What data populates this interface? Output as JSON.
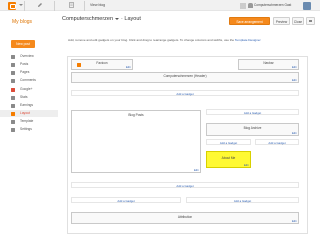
{
  "topbar": {
    "view_blog": "View blog",
    "user_name": "Computerschmerzen Gast",
    "icons": [
      "blogger-logo-icon",
      "pencil-icon",
      "document-icon",
      "apps-grid-icon",
      "notifications-icon"
    ]
  },
  "header": {
    "my_blogs": "My blogs",
    "blog_name": "Computerschmerzen",
    "page": "Layout",
    "save": "Save arrangement",
    "preview": "Preview",
    "close": "Close"
  },
  "sidebar": {
    "new_post": "New post",
    "items": [
      {
        "label": "Overview",
        "icon": "overview-icon",
        "color": "#8a8a8a"
      },
      {
        "label": "Posts",
        "icon": "posts-icon",
        "color": "#8a8a8a"
      },
      {
        "label": "Pages",
        "icon": "pages-icon",
        "color": "#8a8a8a"
      },
      {
        "label": "Comments",
        "icon": "comments-icon",
        "color": "#8a8a8a"
      },
      {
        "label": "Google+",
        "icon": "google-plus-icon",
        "color": "#dd4b39"
      },
      {
        "label": "Stats",
        "icon": "stats-icon",
        "color": "#8a8a8a"
      },
      {
        "label": "Earnings",
        "icon": "earnings-icon",
        "color": "#8a8a8a"
      },
      {
        "label": "Layout",
        "icon": "layout-icon",
        "color": "#f57d00",
        "active": true
      },
      {
        "label": "Template",
        "icon": "template-icon",
        "color": "#8a8a8a"
      },
      {
        "label": "Settings",
        "icon": "settings-icon",
        "color": "#8a8a8a"
      }
    ]
  },
  "intro": {
    "text": "Add, remove and edit gadgets on your blog. Click and drag to rearrange gadgets. To change columns and widths, use the ",
    "link": "Template Designer"
  },
  "layout": {
    "favicon": "Favicon",
    "navbar": "Navbar",
    "header": "Computerschmerzen (Header)",
    "blog_posts": "Blog Posts",
    "blog_archive": "Blog Archive",
    "about_me": "About Me",
    "attribution": "Attribution",
    "edit": "Edit",
    "add_gadget": "Add a Gadget"
  },
  "colors": {
    "accent": "#f5891c",
    "active_nav": "#dd4b39",
    "highlight": "#fff933",
    "link": "#2a5db0"
  }
}
